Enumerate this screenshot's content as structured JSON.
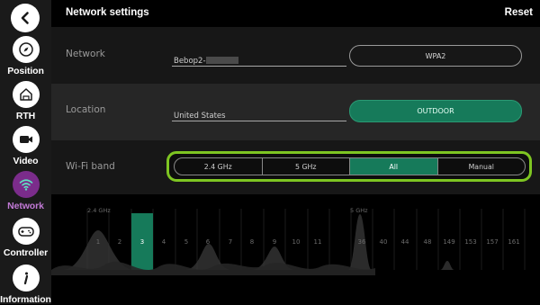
{
  "sidebar": {
    "back_icon": "chevron-left-icon",
    "items": [
      {
        "label": "Position",
        "icon": "compass-icon",
        "active": false
      },
      {
        "label": "RTH",
        "icon": "home-icon",
        "active": false
      },
      {
        "label": "Video",
        "icon": "video-camera-icon",
        "active": false
      },
      {
        "label": "Network",
        "icon": "wifi-icon",
        "active": true
      },
      {
        "label": "Controller",
        "icon": "gamepad-icon",
        "active": false
      },
      {
        "label": "Information",
        "icon": "info-icon",
        "active": false
      }
    ]
  },
  "header": {
    "title": "Network settings",
    "reset_label": "Reset"
  },
  "network": {
    "label": "Network",
    "value": "Bebop2-",
    "security_label": "WPA2"
  },
  "location": {
    "label": "Location",
    "value": "United States",
    "mode_label": "OUTDOOR"
  },
  "wifi_band": {
    "label": "Wi-Fi band",
    "options": [
      "2.4 GHz",
      "5 GHz",
      "All",
      "Manual"
    ],
    "selected": "All"
  },
  "spectrum": {
    "band_24_label": "2.4 GHz",
    "band_5_label": "5 GHz",
    "channels_24": [
      "1",
      "2",
      "3",
      "4",
      "5",
      "6",
      "7",
      "8",
      "9",
      "10",
      "11"
    ],
    "channels_5": [
      "36",
      "40",
      "44",
      "48",
      "149",
      "153",
      "157",
      "161"
    ],
    "selected_channel": "3"
  },
  "colors": {
    "accent_green": "#167a5a",
    "highlight_green": "#7ec522",
    "active_purple": "#7b2c8b"
  }
}
